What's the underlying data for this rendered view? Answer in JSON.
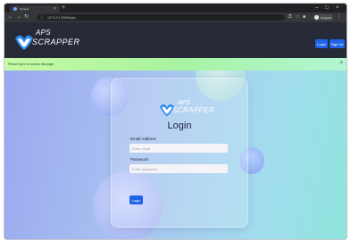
{
  "browser": {
    "tab_title": "Scraper",
    "tab_close": "×",
    "new_tab": "+",
    "window_controls": [
      "–",
      "□",
      "×"
    ],
    "nav": {
      "back": "←",
      "forward": "→",
      "reload": "↻"
    },
    "url": "127.0.0.1:5000/login",
    "profile_label": "Incognito",
    "menu": "⋮"
  },
  "site": {
    "logo_line1": "APS",
    "logo_line2": "SCRAPPER",
    "header_buttons": {
      "login": "Login",
      "signup": "Sign Up"
    },
    "brand_colors": {
      "header_bg": "#262a36",
      "primary": "#1f63e6",
      "logo_blue": "#2f8ff0"
    }
  },
  "alert": {
    "message": "Please log in to access this page.",
    "close": "×"
  },
  "login_card": {
    "logo_line1": "APS",
    "logo_line2": "SCRAPPER",
    "title": "Login",
    "email_label": "Email Address",
    "email_placeholder": "Enter email",
    "email_value": "",
    "password_label": "Password",
    "password_placeholder": "Enter password",
    "password_value": "",
    "submit_label": "Login"
  }
}
